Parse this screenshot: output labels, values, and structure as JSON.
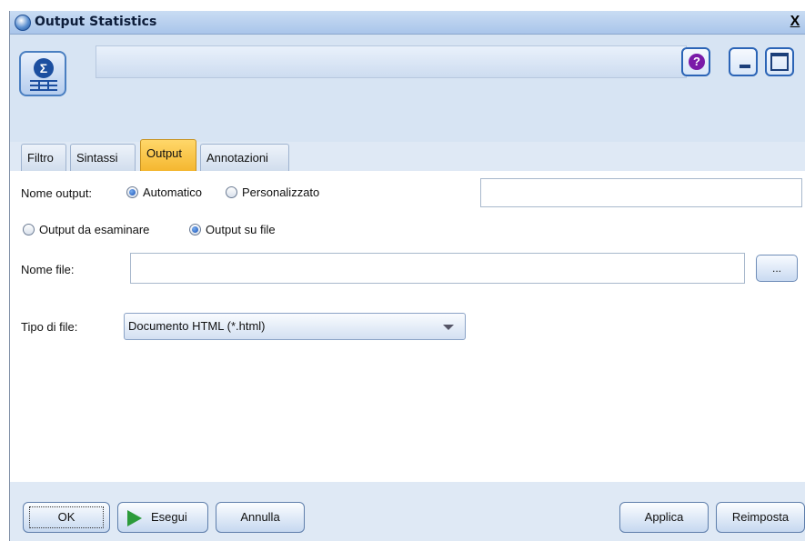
{
  "window": {
    "title": "Output Statistics",
    "close_label": "X"
  },
  "header": {
    "node_icon": "statistics-sigma-icon",
    "help_icon": "help-icon",
    "minimize_icon": "minimize-icon",
    "maximize_icon": "maximize-icon"
  },
  "tabs": [
    {
      "label": "Filtro"
    },
    {
      "label": "Sintassi"
    },
    {
      "label": "Output",
      "selected": true
    },
    {
      "label": "Annotazioni"
    }
  ],
  "output_name": {
    "label": "Nome output:",
    "options": [
      {
        "label": "Automatico",
        "selected": true
      },
      {
        "label": "Personalizzato",
        "selected": false
      }
    ],
    "custom_value": ""
  },
  "output_mode": {
    "options": [
      {
        "label": "Output da esaminare",
        "selected": false
      },
      {
        "label": "Output su file",
        "selected": true
      }
    ]
  },
  "file_name": {
    "label": "Nome file:",
    "value": "",
    "browse_label": "..."
  },
  "file_type": {
    "label": "Tipo di file:",
    "selected": "Documento HTML (*.html)"
  },
  "buttons": {
    "ok": "OK",
    "run": "Esegui",
    "cancel": "Annulla",
    "apply": "Applica",
    "reset": "Reimposta"
  }
}
